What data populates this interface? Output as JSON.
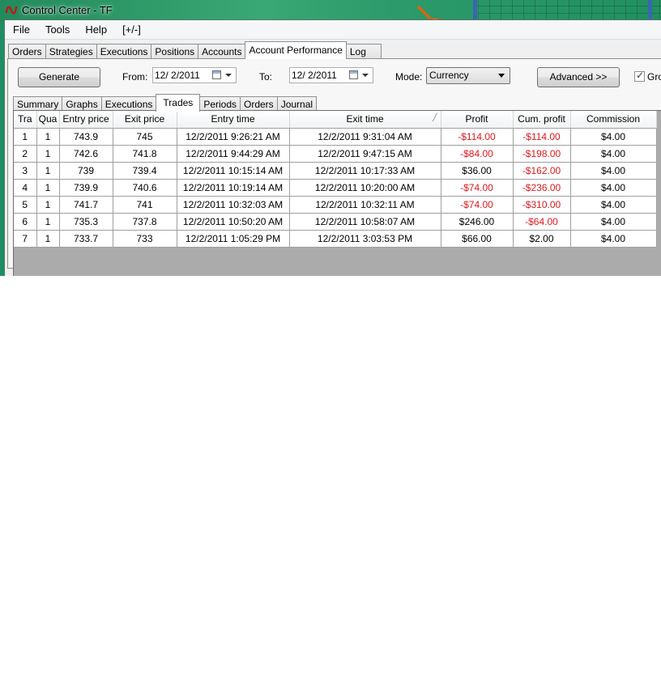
{
  "window": {
    "title": "Control Center - TF"
  },
  "menu": [
    "File",
    "Tools",
    "Help",
    "[+/-]"
  ],
  "main_tabs": [
    {
      "label": "Orders",
      "active": false
    },
    {
      "label": "Strategies",
      "active": false
    },
    {
      "label": "Executions",
      "active": false
    },
    {
      "label": "Positions",
      "active": false
    },
    {
      "label": "Accounts",
      "active": false
    },
    {
      "label": "Account Performance",
      "active": true
    },
    {
      "label": "Log",
      "active": false
    }
  ],
  "controls": {
    "generate_label": "Generate",
    "from_label": "From:",
    "from_value": "12/  2/2011",
    "to_label": "To:",
    "to_value": "12/  2/2011",
    "mode_label": "Mode:",
    "mode_value": "Currency",
    "advanced_label": "Advanced >>",
    "group_label": "Gro",
    "group_checked": true
  },
  "sub_tabs": [
    {
      "label": "Summary",
      "active": false
    },
    {
      "label": "Graphs",
      "active": false
    },
    {
      "label": "Executions",
      "active": false
    },
    {
      "label": "Trades",
      "active": true
    },
    {
      "label": "Periods",
      "active": false
    },
    {
      "label": "Orders",
      "active": false
    },
    {
      "label": "Journal",
      "active": false
    }
  ],
  "table": {
    "columns": [
      "Tra",
      "Qua",
      "Entry price",
      "Exit price",
      "Entry time",
      "Exit time",
      "Profit",
      "Cum. profit",
      "Commission"
    ],
    "rows": [
      [
        "1",
        "1",
        "743.9",
        "745",
        "12/2/2011 9:26:21 AM",
        "12/2/2011 9:31:04 AM",
        "-$114.00",
        "-$114.00",
        "$4.00"
      ],
      [
        "2",
        "1",
        "742.6",
        "741.8",
        "12/2/2011 9:44:29 AM",
        "12/2/2011 9:47:15 AM",
        "-$84.00",
        "-$198.00",
        "$4.00"
      ],
      [
        "3",
        "1",
        "739",
        "739.4",
        "12/2/2011 10:15:14 AM",
        "12/2/2011 10:17:33 AM",
        "$36.00",
        "-$162.00",
        "$4.00"
      ],
      [
        "4",
        "1",
        "739.9",
        "740.6",
        "12/2/2011 10:19:14 AM",
        "12/2/2011 10:20:00 AM",
        "-$74.00",
        "-$236.00",
        "$4.00"
      ],
      [
        "5",
        "1",
        "741.7",
        "741",
        "12/2/2011 10:32:03 AM",
        "12/2/2011 10:32:11 AM",
        "-$74.00",
        "-$310.00",
        "$4.00"
      ],
      [
        "6",
        "1",
        "735.3",
        "737.8",
        "12/2/2011 10:50:20 AM",
        "12/2/2011 10:58:07 AM",
        "$246.00",
        "-$64.00",
        "$4.00"
      ],
      [
        "7",
        "1",
        "733.7",
        "733",
        "12/2/2011 1:05:29 PM",
        "12/2/2011 3:03:53 PM",
        "$66.00",
        "$2.00",
        "$4.00"
      ]
    ]
  },
  "colors": {
    "negative": "#e0171b",
    "desktop": "#1f8e64",
    "grid_empty": "#ababab"
  },
  "icons": {
    "app": "ninja-logo-icon",
    "cursor": "pointing-hand-icon",
    "calendar": "calendar-icon"
  }
}
